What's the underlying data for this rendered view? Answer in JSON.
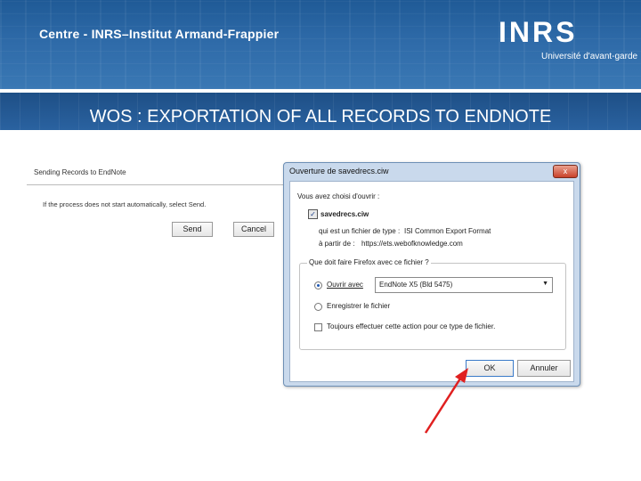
{
  "banner": {
    "institute": "Centre - INRS–Institut Armand-Frappier",
    "logo": "INRS",
    "tagline": "Université d'avant-garde"
  },
  "slide": {
    "title": "WOS : EXPORTATION OF ALL RECORDS TO ENDNOTE"
  },
  "webpage": {
    "heading": "Sending Records to EndNote",
    "message": "If the process does not start automatically, select Send.",
    "send_label": "Send",
    "cancel_label": "Cancel"
  },
  "dialog": {
    "title": "Ouverture de savedrecs.ciw",
    "close_glyph": "x",
    "intro": "Vous avez choisi d'ouvrir :",
    "file_name": "savedrecs.ciw",
    "type_label": "qui est un fichier de type :",
    "type_value": "ISI Common Export Format",
    "from_label": "à partir de :",
    "from_value": "https://ets.webofknowledge.com",
    "question": "Que doit faire Firefox avec ce fichier ?",
    "open_with_label": "Ouvrir avec",
    "open_with_app": "EndNote X5 (Bld 5475)",
    "save_label": "Enregistrer le fichier",
    "always_label": "Toujours effectuer cette action pour ce type de fichier.",
    "ok_label": "OK",
    "cancel_label": "Annuler"
  },
  "colors": {
    "banner": "#2e6aa8",
    "dialog_frame": "#c9d9ec",
    "annotation_arrow": "#e02020"
  }
}
